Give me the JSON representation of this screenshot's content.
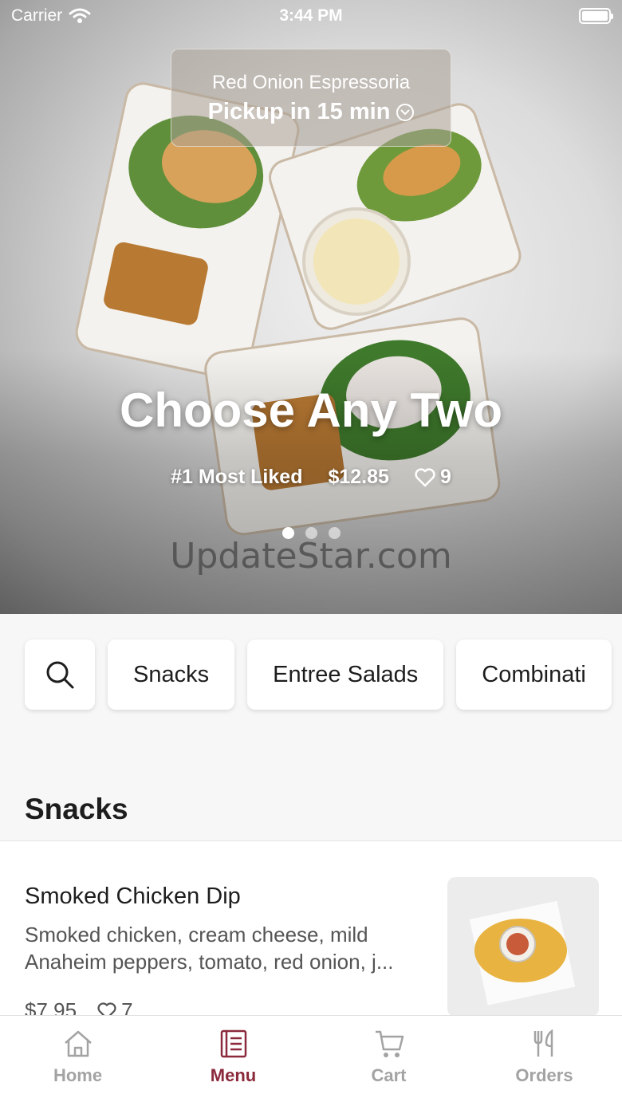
{
  "status_bar": {
    "carrier": "Carrier",
    "time": "3:44 PM"
  },
  "location": {
    "name": "Red Onion Espressoria",
    "pickup": "Pickup in 15 min"
  },
  "hero": {
    "title": "Choose Any Two",
    "tag": "#1 Most Liked",
    "price": "$12.85",
    "likes": "9",
    "pages": 3,
    "active_page": 1
  },
  "watermark": "UpdateStar.com",
  "categories": [
    "Snacks",
    "Entree Salads",
    "Combinati"
  ],
  "section": {
    "title": "Snacks"
  },
  "items": [
    {
      "name": "Smoked Chicken Dip",
      "description": "Smoked chicken, cream cheese, mild Anaheim peppers, tomato, red onion, j...",
      "price": "$7.95",
      "likes": "7"
    }
  ],
  "tabs": [
    {
      "label": "Home",
      "icon": "home-icon",
      "active": false
    },
    {
      "label": "Menu",
      "icon": "menu-icon",
      "active": true
    },
    {
      "label": "Cart",
      "icon": "cart-icon",
      "active": false
    },
    {
      "label": "Orders",
      "icon": "orders-icon",
      "active": false
    }
  ],
  "colors": {
    "accent": "#8b2a3c",
    "inactive": "#a3a3a3"
  }
}
